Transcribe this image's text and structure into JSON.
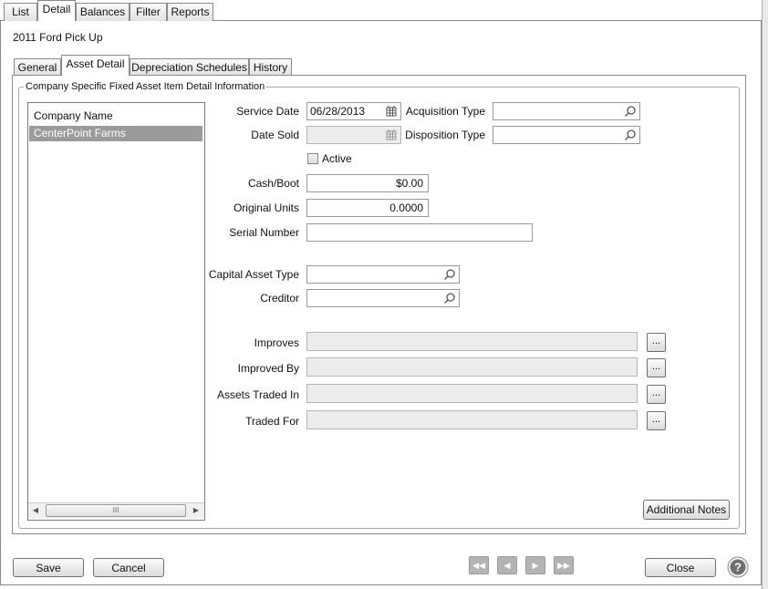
{
  "top_tabs": [
    "List",
    "Detail",
    "Balances",
    "Filter",
    "Reports"
  ],
  "active_top_tab": "Detail",
  "record_title": "2011 Ford Pick Up",
  "sub_tabs": [
    "General",
    "Asset Detail",
    "Depreciation Schedules",
    "History"
  ],
  "active_sub_tab": "Asset Detail",
  "group_title": "Company Specific Fixed Asset Item Detail Information",
  "company_list": {
    "header": "Company Name",
    "items": [
      "CenterPoint Farms"
    ],
    "selected": "CenterPoint Farms",
    "scroll_grip": "III"
  },
  "fields": {
    "service_date": {
      "label": "Service Date",
      "value": "06/28/2013"
    },
    "acquisition_type": {
      "label": "Acquisition Type",
      "value": ""
    },
    "date_sold": {
      "label": "Date Sold",
      "value": ""
    },
    "disposition_type": {
      "label": "Disposition Type",
      "value": ""
    },
    "active": {
      "label": "Active",
      "checked": false
    },
    "cash_boot": {
      "label": "Cash/Boot",
      "value": "$0.00"
    },
    "original_units": {
      "label": "Original Units",
      "value": "0.0000"
    },
    "serial_number": {
      "label": "Serial Number",
      "value": ""
    },
    "capital_asset_type": {
      "label": "Capital Asset Type",
      "value": ""
    },
    "creditor": {
      "label": "Creditor",
      "value": ""
    },
    "improves": {
      "label": "Improves",
      "value": ""
    },
    "improved_by": {
      "label": "Improved By",
      "value": ""
    },
    "assets_traded_in": {
      "label": "Assets Traded In",
      "value": ""
    },
    "traded_for": {
      "label": "Traded For",
      "value": ""
    }
  },
  "ellipsis_label": "...",
  "buttons": {
    "additional_notes": "Additional Notes",
    "save": "Save",
    "cancel": "Cancel",
    "close": "Close"
  },
  "icons": {
    "calendar": "calendar-icon",
    "lookup": "magnifier-icon",
    "nav": [
      "first-record-icon",
      "previous-record-icon",
      "next-record-icon",
      "last-record-icon"
    ],
    "help": "help-icon"
  }
}
